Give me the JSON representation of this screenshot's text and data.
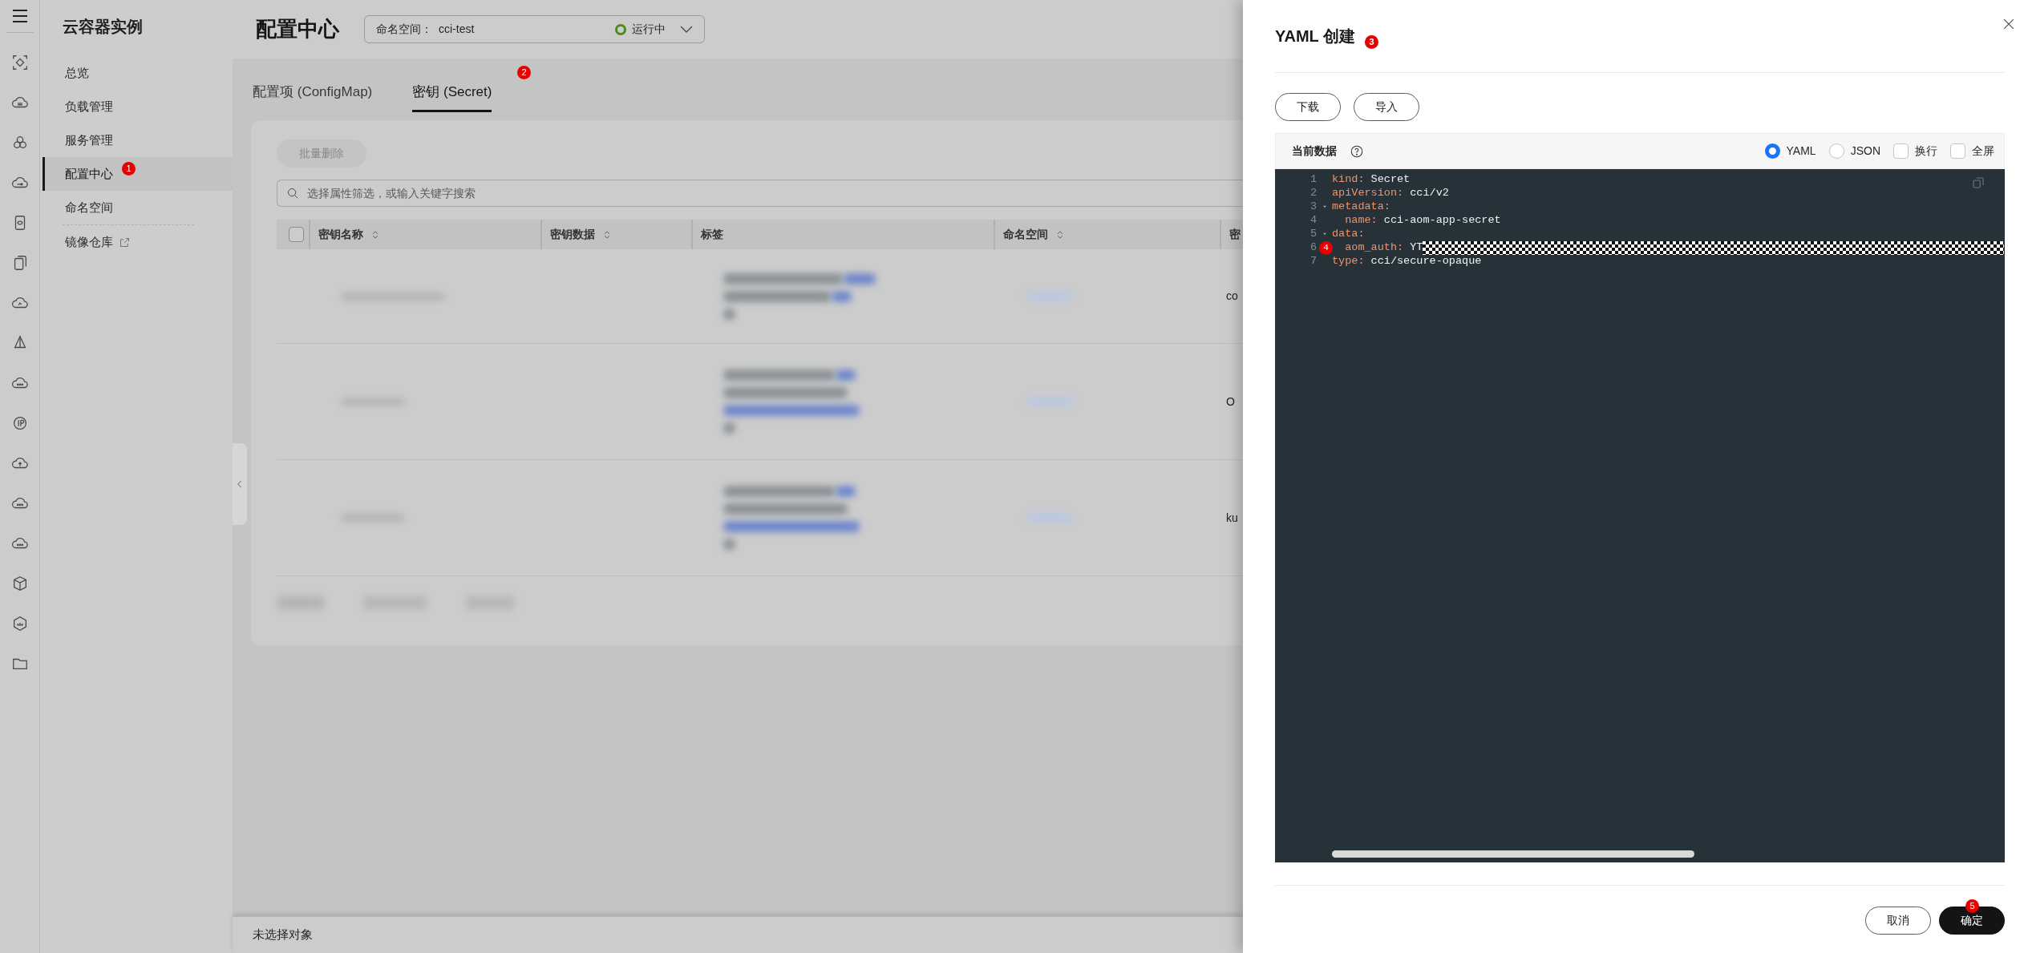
{
  "nav": {
    "title": "云容器实例",
    "items": [
      {
        "label": "总览",
        "selected": false,
        "external": false
      },
      {
        "label": "负载管理",
        "selected": false,
        "external": false
      },
      {
        "label": "服务管理",
        "selected": false,
        "external": false
      },
      {
        "label": "配置中心",
        "selected": true,
        "external": false,
        "marker": "1"
      },
      {
        "label": "命名空间",
        "selected": false,
        "external": false
      },
      {
        "label": "镜像仓库",
        "selected": false,
        "external": true
      }
    ]
  },
  "header": {
    "title": "配置中心",
    "namespace_label": "命名空间：",
    "namespace": "cci-test",
    "status": "运行中"
  },
  "tabs": [
    {
      "label": "配置项 (ConfigMap)",
      "selected": false
    },
    {
      "label": "密钥 (Secret)",
      "selected": true,
      "marker": "2"
    }
  ],
  "toolbar": {
    "batch_delete": {
      "label": "批量删除",
      "disabled": true
    },
    "search": {
      "placeholder": "选择属性筛选，或输入关键字搜索"
    }
  },
  "table": {
    "header_checkbox": {
      "checked": false
    },
    "columns": [
      {
        "label": "密钥名称",
        "sortable": true
      },
      {
        "label": "密钥数据",
        "sortable": true
      },
      {
        "label": "标签",
        "sortable": false
      },
      {
        "label": "命名空间",
        "sortable": true
      },
      {
        "label": "密",
        "sortable": false
      }
    ],
    "rows": [
      {
        "column_5": "co"
      },
      {
        "column_5": "O"
      },
      {
        "column_5": "ku"
      }
    ]
  },
  "status_bar": "未选择对象",
  "drawer": {
    "title": "YAML 创建",
    "marker": "3",
    "buttons": [
      "下载",
      "导入"
    ],
    "data_label": "当前数据",
    "formats": [
      {
        "label": "YAML",
        "selected": true
      },
      {
        "label": "JSON",
        "selected": false
      }
    ],
    "options": [
      {
        "label": "换行",
        "checked": false
      },
      {
        "label": "全屏",
        "checked": false
      }
    ],
    "code": [
      {
        "number": "1",
        "key": "kind:",
        "value": " Secret",
        "foldable": false,
        "redacted": false
      },
      {
        "number": "2",
        "key": "apiVersion:",
        "value": " cci/v2",
        "foldable": false,
        "redacted": false
      },
      {
        "number": "3",
        "key": "metadata:",
        "foldable": true,
        "redacted": false
      },
      {
        "number": "4",
        "key": "  name:",
        "value": " cci-aom-app-secret",
        "foldable": false,
        "redacted": false
      },
      {
        "number": "5",
        "key": "data:",
        "foldable": true,
        "redacted": false
      },
      {
        "number": "6",
        "key": "  aom_auth:",
        "value": " YT",
        "foldable": false,
        "redacted": true,
        "marker": "4"
      },
      {
        "number": "7",
        "key": "type:",
        "value": " cci/secure-opaque",
        "foldable": false,
        "redacted": false
      }
    ],
    "footer_buttons": [
      {
        "label": "取消",
        "kind": "secondary"
      },
      {
        "label": "确定",
        "kind": "primary",
        "marker": "5"
      }
    ]
  }
}
